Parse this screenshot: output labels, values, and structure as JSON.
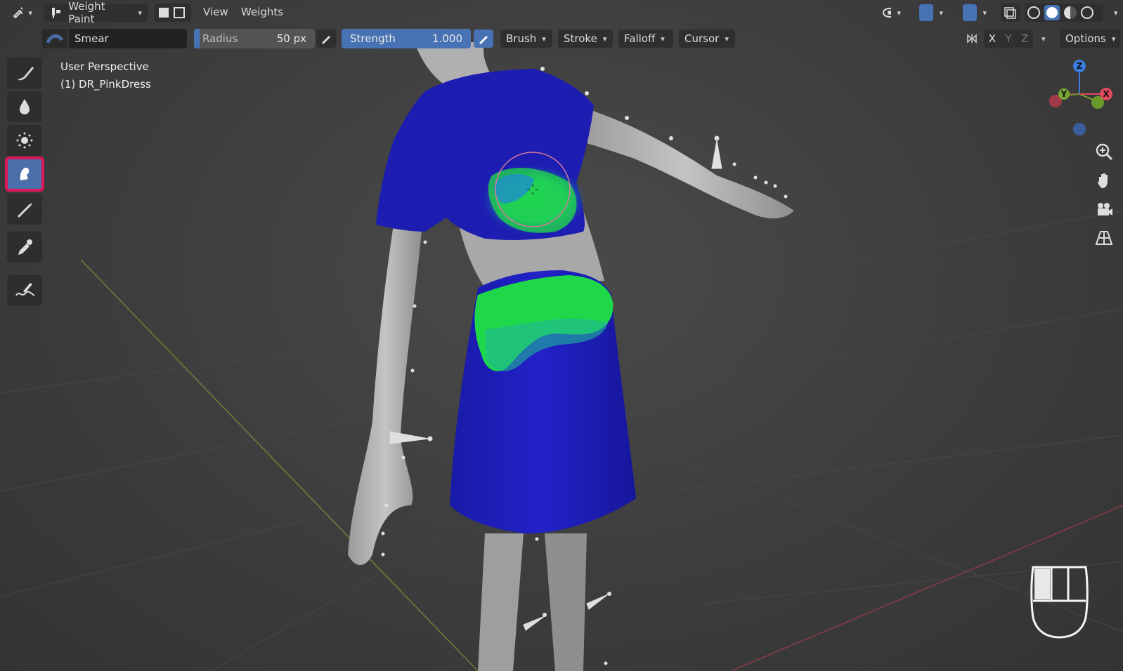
{
  "header": {
    "editor_icon": "editor-type-icon",
    "mode_label": "Weight Paint",
    "menus": [
      "View",
      "Weights"
    ]
  },
  "toolbar": {
    "brush_name": "Smear",
    "radius_label": "Radius",
    "radius_value": "50 px",
    "strength_label": "Strength",
    "strength_value": "1.000",
    "dropdowns": [
      "Brush",
      "Stroke",
      "Falloff",
      "Cursor"
    ],
    "axis_x": "X",
    "axis_y": "Y",
    "axis_z": "Z",
    "options_label": "Options"
  },
  "viewport": {
    "perspective_label": "User Perspective",
    "object_label": "(1) DR_PinkDress"
  },
  "tools": [
    {
      "name": "draw-tool",
      "icon": "brush-icon",
      "active": false
    },
    {
      "name": "blur-tool",
      "icon": "drop-icon",
      "active": false
    },
    {
      "name": "average-tool",
      "icon": "dots-icon",
      "active": false
    },
    {
      "name": "smear-tool",
      "icon": "smear-finger-icon",
      "active": true
    },
    {
      "name": "gradient-tool",
      "icon": "gradient-icon",
      "active": false
    },
    {
      "name": "sample-weight-tool",
      "icon": "eyedropper-icon",
      "active": false
    },
    {
      "name": "annotate-tool",
      "icon": "annotate-icon",
      "active": false
    }
  ],
  "gizmo": {
    "z": "Z",
    "y": "Y",
    "x": "X"
  },
  "colors": {
    "accent_blue": "#4772b3",
    "active_outline": "#e0155a",
    "weight_low": "#1616a8",
    "weight_high": "#1ed84a"
  }
}
